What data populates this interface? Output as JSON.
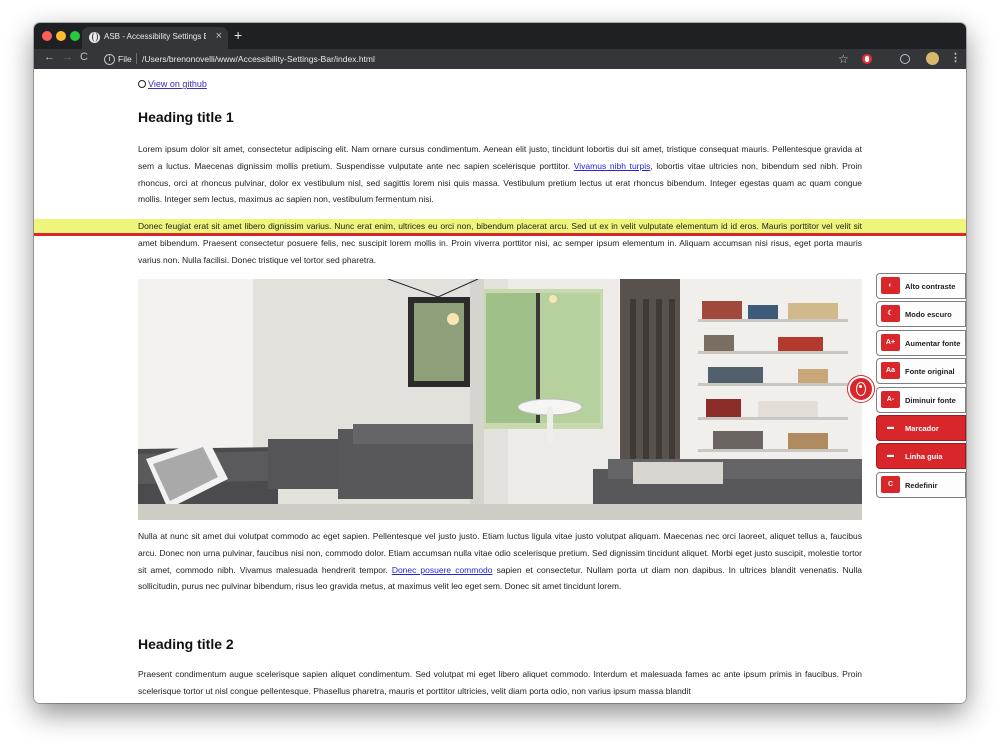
{
  "browser": {
    "tab_title": "ASB - Accessibility Settings Ba",
    "tab_close": "×",
    "new_tab": "+",
    "back": "←",
    "forward": "→",
    "reload": "C",
    "info": "i",
    "scheme": "File",
    "url": "/Users/brenonovelli/www/Accessibility-Settings-Bar/index.html",
    "star": "☆",
    "menu": "⋮"
  },
  "page": {
    "github_link": "View on github",
    "heading1": "Heading title 1",
    "heading2": "Heading title 2",
    "p1_before": "Lorem ipsum dolor sit amet, consectetur adipiscing elit. Nam ornare cursus condimentum. Aenean elit justo, tincidunt lobortis dui sit amet, tristique consequat mauris. Pellentesque gravida at sem a luctus. Maecenas dignissim mollis pretium. Suspendisse vulputate ante nec sapien scelerisque porttitor. ",
    "p1_link": "Vivamus nibh turpis",
    "p1_after": ", lobortis vitae ultricies non, bibendum sed nibh. Proin rhoncus, orci at rhoncus pulvinar, dolor ex vestibulum nisl, sed sagittis lorem nisi quis massa. Vestibulum pretium lectus ut erat rhoncus bibendum. Integer egestas quam ac quam congue mollis. Integer sem lectus, maximus ac sapien non, vestibulum fermentum nisi.",
    "p2": "Donec feugiat erat sit amet libero dignissim varius. Nunc erat enim, ultrices eu orci non, bibendum placerat arcu. Sed ut ex in velit vulputate elementum id id eros. Mauris porttitor vel velit sit amet bibendum. Praesent consectetur posuere felis, nec suscipit lorem mollis in. Proin viverra porttitor nisi, ac semper ipsum elementum in. Aliquam accumsan nisi risus, eget porta mauris varius non. Nulla facilisi. Donec tristique vel tortor sed pharetra.",
    "p3_before": "Nulla at nunc sit amet dui volutpat commodo ac eget sapien. Pellentesque vel justo justo. Etiam luctus ligula vitae justo volutpat aliquam. Maecenas nec orci laoreet, aliquet tellus a, faucibus arcu. Donec non urna pulvinar, faucibus nisi non, commodo dolor. Etiam accumsan nulla vitae odio scelerisque pretium. Sed dignissim tincidunt aliquet. Morbi eget justo suscipit, molestie tortor sit amet, commodo nibh. Vivamus malesuada hendrerit tempor. ",
    "p3_link": "Donec posuere commodo",
    "p3_after": " sapien et consectetur. Nullam porta ut diam non dapibus. In ultrices blandit venenatis. Nulla sollicitudin, purus nec pulvinar bibendum, risus leo gravida metus, at maximus velit leo eget sem. Donec sit amet tincidunt lorem.",
    "p4": "Praesent condimentum augue scelerisque sapien aliquet condimentum. Sed volutpat mi eget libero aliquet commodo. Interdum et malesuada fames ac ante ipsum primis in faucibus. Proin scelerisque tortor ut nisl congue pellentesque. Phasellus pharetra, mauris et porttitor ultricies, velit diam porta odio, non varius ipsum massa blandit"
  },
  "asb": {
    "items": [
      {
        "icon": "◐",
        "label": "Alto contraste",
        "active": false
      },
      {
        "icon": "☾",
        "label": "Modo escuro",
        "active": false
      },
      {
        "icon": "A+",
        "label": "Aumentar fonte",
        "active": false
      },
      {
        "icon": "Aa",
        "label": "Fonte original",
        "active": false
      },
      {
        "icon": "A-",
        "label": "Diminuir fonte",
        "active": false
      },
      {
        "icon": "▬",
        "label": "Marcador",
        "active": true
      },
      {
        "icon": "▬",
        "label": "Linha guia",
        "active": true
      },
      {
        "icon": "C",
        "label": "Redefinir",
        "active": false
      }
    ]
  },
  "colors": {
    "accent": "#d9262b",
    "highlight": "#edf57a"
  }
}
